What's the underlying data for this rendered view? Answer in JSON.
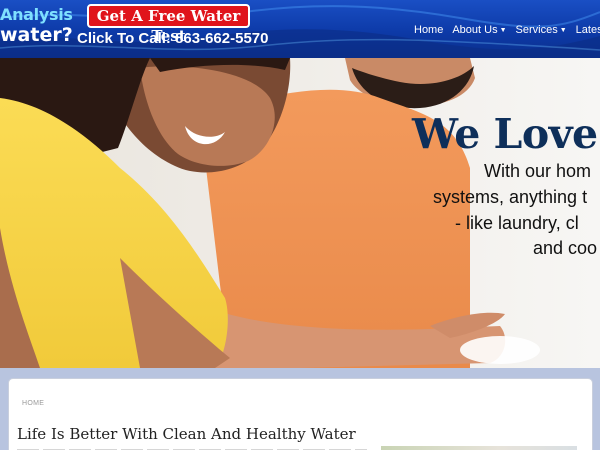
{
  "header": {
    "logo_line1": "Analysis",
    "logo_line2": "water?",
    "cta_label": "Get A Free Water Test",
    "call_text": "Click To Call: 863-662-5570",
    "nav": [
      {
        "label": "Home"
      },
      {
        "label": "About Us"
      },
      {
        "label": "Services"
      },
      {
        "label": "Latest Pro"
      }
    ]
  },
  "hero": {
    "title": "We Love",
    "lines": [
      "With our hom",
      "systems, anything t",
      "- like laundry, cl",
      "and coo"
    ]
  },
  "content": {
    "breadcrumb": "HOME",
    "title": "Life Is Better With Clean And Healthy Water"
  },
  "colors": {
    "header_blue": "#0d3aa8",
    "cta_red": "#e0141b",
    "hero_title": "#0e2f5a"
  }
}
